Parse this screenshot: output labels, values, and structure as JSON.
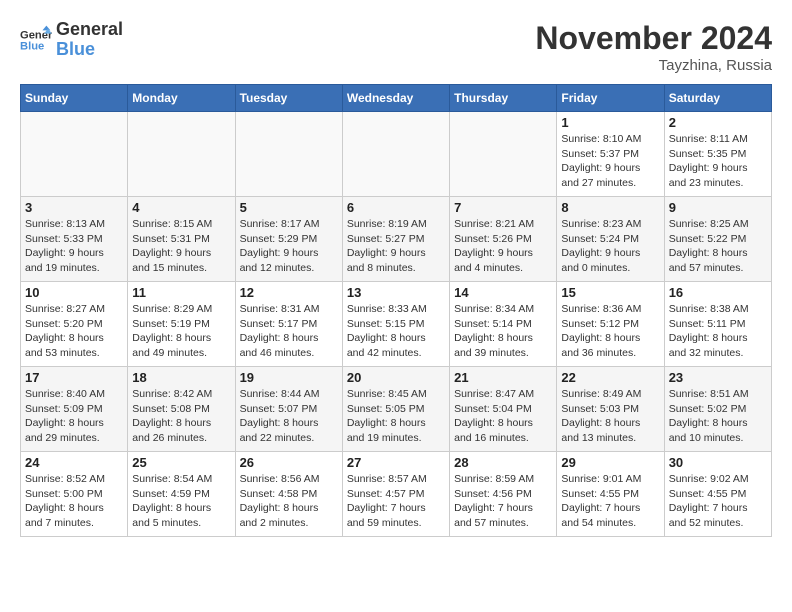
{
  "logo": {
    "line1": "General",
    "line2": "Blue"
  },
  "title": "November 2024",
  "location": "Tayzhina, Russia",
  "days_of_week": [
    "Sunday",
    "Monday",
    "Tuesday",
    "Wednesday",
    "Thursday",
    "Friday",
    "Saturday"
  ],
  "weeks": [
    [
      {
        "day": "",
        "info": ""
      },
      {
        "day": "",
        "info": ""
      },
      {
        "day": "",
        "info": ""
      },
      {
        "day": "",
        "info": ""
      },
      {
        "day": "",
        "info": ""
      },
      {
        "day": "1",
        "info": "Sunrise: 8:10 AM\nSunset: 5:37 PM\nDaylight: 9 hours\nand 27 minutes."
      },
      {
        "day": "2",
        "info": "Sunrise: 8:11 AM\nSunset: 5:35 PM\nDaylight: 9 hours\nand 23 minutes."
      }
    ],
    [
      {
        "day": "3",
        "info": "Sunrise: 8:13 AM\nSunset: 5:33 PM\nDaylight: 9 hours\nand 19 minutes."
      },
      {
        "day": "4",
        "info": "Sunrise: 8:15 AM\nSunset: 5:31 PM\nDaylight: 9 hours\nand 15 minutes."
      },
      {
        "day": "5",
        "info": "Sunrise: 8:17 AM\nSunset: 5:29 PM\nDaylight: 9 hours\nand 12 minutes."
      },
      {
        "day": "6",
        "info": "Sunrise: 8:19 AM\nSunset: 5:27 PM\nDaylight: 9 hours\nand 8 minutes."
      },
      {
        "day": "7",
        "info": "Sunrise: 8:21 AM\nSunset: 5:26 PM\nDaylight: 9 hours\nand 4 minutes."
      },
      {
        "day": "8",
        "info": "Sunrise: 8:23 AM\nSunset: 5:24 PM\nDaylight: 9 hours\nand 0 minutes."
      },
      {
        "day": "9",
        "info": "Sunrise: 8:25 AM\nSunset: 5:22 PM\nDaylight: 8 hours\nand 57 minutes."
      }
    ],
    [
      {
        "day": "10",
        "info": "Sunrise: 8:27 AM\nSunset: 5:20 PM\nDaylight: 8 hours\nand 53 minutes."
      },
      {
        "day": "11",
        "info": "Sunrise: 8:29 AM\nSunset: 5:19 PM\nDaylight: 8 hours\nand 49 minutes."
      },
      {
        "day": "12",
        "info": "Sunrise: 8:31 AM\nSunset: 5:17 PM\nDaylight: 8 hours\nand 46 minutes."
      },
      {
        "day": "13",
        "info": "Sunrise: 8:33 AM\nSunset: 5:15 PM\nDaylight: 8 hours\nand 42 minutes."
      },
      {
        "day": "14",
        "info": "Sunrise: 8:34 AM\nSunset: 5:14 PM\nDaylight: 8 hours\nand 39 minutes."
      },
      {
        "day": "15",
        "info": "Sunrise: 8:36 AM\nSunset: 5:12 PM\nDaylight: 8 hours\nand 36 minutes."
      },
      {
        "day": "16",
        "info": "Sunrise: 8:38 AM\nSunset: 5:11 PM\nDaylight: 8 hours\nand 32 minutes."
      }
    ],
    [
      {
        "day": "17",
        "info": "Sunrise: 8:40 AM\nSunset: 5:09 PM\nDaylight: 8 hours\nand 29 minutes."
      },
      {
        "day": "18",
        "info": "Sunrise: 8:42 AM\nSunset: 5:08 PM\nDaylight: 8 hours\nand 26 minutes."
      },
      {
        "day": "19",
        "info": "Sunrise: 8:44 AM\nSunset: 5:07 PM\nDaylight: 8 hours\nand 22 minutes."
      },
      {
        "day": "20",
        "info": "Sunrise: 8:45 AM\nSunset: 5:05 PM\nDaylight: 8 hours\nand 19 minutes."
      },
      {
        "day": "21",
        "info": "Sunrise: 8:47 AM\nSunset: 5:04 PM\nDaylight: 8 hours\nand 16 minutes."
      },
      {
        "day": "22",
        "info": "Sunrise: 8:49 AM\nSunset: 5:03 PM\nDaylight: 8 hours\nand 13 minutes."
      },
      {
        "day": "23",
        "info": "Sunrise: 8:51 AM\nSunset: 5:02 PM\nDaylight: 8 hours\nand 10 minutes."
      }
    ],
    [
      {
        "day": "24",
        "info": "Sunrise: 8:52 AM\nSunset: 5:00 PM\nDaylight: 8 hours\nand 7 minutes."
      },
      {
        "day": "25",
        "info": "Sunrise: 8:54 AM\nSunset: 4:59 PM\nDaylight: 8 hours\nand 5 minutes."
      },
      {
        "day": "26",
        "info": "Sunrise: 8:56 AM\nSunset: 4:58 PM\nDaylight: 8 hours\nand 2 minutes."
      },
      {
        "day": "27",
        "info": "Sunrise: 8:57 AM\nSunset: 4:57 PM\nDaylight: 7 hours\nand 59 minutes."
      },
      {
        "day": "28",
        "info": "Sunrise: 8:59 AM\nSunset: 4:56 PM\nDaylight: 7 hours\nand 57 minutes."
      },
      {
        "day": "29",
        "info": "Sunrise: 9:01 AM\nSunset: 4:55 PM\nDaylight: 7 hours\nand 54 minutes."
      },
      {
        "day": "30",
        "info": "Sunrise: 9:02 AM\nSunset: 4:55 PM\nDaylight: 7 hours\nand 52 minutes."
      }
    ]
  ]
}
